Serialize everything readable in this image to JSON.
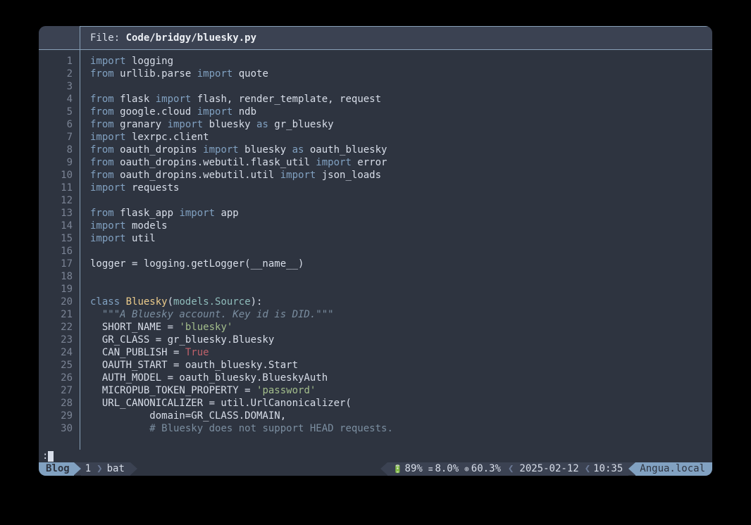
{
  "header": {
    "label": "File: ",
    "path": "Code/bridgy/bluesky.py"
  },
  "lines": [
    {
      "n": "1",
      "tokens": [
        {
          "c": "kw",
          "t": "import"
        },
        {
          "c": "fg",
          "t": " logging"
        }
      ]
    },
    {
      "n": "2",
      "tokens": [
        {
          "c": "kw",
          "t": "from"
        },
        {
          "c": "fg",
          "t": " urllib.parse "
        },
        {
          "c": "kw",
          "t": "import"
        },
        {
          "c": "fg",
          "t": " quote"
        }
      ]
    },
    {
      "n": "3",
      "tokens": []
    },
    {
      "n": "4",
      "tokens": [
        {
          "c": "kw",
          "t": "from"
        },
        {
          "c": "fg",
          "t": " flask "
        },
        {
          "c": "kw",
          "t": "import"
        },
        {
          "c": "fg",
          "t": " flash, render_template, request"
        }
      ]
    },
    {
      "n": "5",
      "tokens": [
        {
          "c": "kw",
          "t": "from"
        },
        {
          "c": "fg",
          "t": " google.cloud "
        },
        {
          "c": "kw",
          "t": "import"
        },
        {
          "c": "fg",
          "t": " ndb"
        }
      ]
    },
    {
      "n": "6",
      "tokens": [
        {
          "c": "kw",
          "t": "from"
        },
        {
          "c": "fg",
          "t": " granary "
        },
        {
          "c": "kw",
          "t": "import"
        },
        {
          "c": "fg",
          "t": " bluesky "
        },
        {
          "c": "kw",
          "t": "as"
        },
        {
          "c": "fg",
          "t": " gr_bluesky"
        }
      ]
    },
    {
      "n": "7",
      "tokens": [
        {
          "c": "kw",
          "t": "import"
        },
        {
          "c": "fg",
          "t": " lexrpc.client"
        }
      ]
    },
    {
      "n": "8",
      "tokens": [
        {
          "c": "kw",
          "t": "from"
        },
        {
          "c": "fg",
          "t": " oauth_dropins "
        },
        {
          "c": "kw",
          "t": "import"
        },
        {
          "c": "fg",
          "t": " bluesky "
        },
        {
          "c": "kw",
          "t": "as"
        },
        {
          "c": "fg",
          "t": " oauth_bluesky"
        }
      ]
    },
    {
      "n": "9",
      "tokens": [
        {
          "c": "kw",
          "t": "from"
        },
        {
          "c": "fg",
          "t": " oauth_dropins.webutil.flask_util "
        },
        {
          "c": "kw",
          "t": "import"
        },
        {
          "c": "fg",
          "t": " error"
        }
      ]
    },
    {
      "n": "10",
      "tokens": [
        {
          "c": "kw",
          "t": "from"
        },
        {
          "c": "fg",
          "t": " oauth_dropins.webutil.util "
        },
        {
          "c": "kw",
          "t": "import"
        },
        {
          "c": "fg",
          "t": " json_loads"
        }
      ]
    },
    {
      "n": "11",
      "tokens": [
        {
          "c": "kw",
          "t": "import"
        },
        {
          "c": "fg",
          "t": " requests"
        }
      ]
    },
    {
      "n": "12",
      "tokens": []
    },
    {
      "n": "13",
      "tokens": [
        {
          "c": "kw",
          "t": "from"
        },
        {
          "c": "fg",
          "t": " flask_app "
        },
        {
          "c": "kw",
          "t": "import"
        },
        {
          "c": "fg",
          "t": " app"
        }
      ]
    },
    {
      "n": "14",
      "tokens": [
        {
          "c": "kw",
          "t": "import"
        },
        {
          "c": "fg",
          "t": " models"
        }
      ]
    },
    {
      "n": "15",
      "tokens": [
        {
          "c": "kw",
          "t": "import"
        },
        {
          "c": "fg",
          "t": " util"
        }
      ]
    },
    {
      "n": "16",
      "tokens": []
    },
    {
      "n": "17",
      "tokens": [
        {
          "c": "fg",
          "t": "logger = logging.getLogger(__name__)"
        }
      ]
    },
    {
      "n": "18",
      "tokens": []
    },
    {
      "n": "19",
      "tokens": []
    },
    {
      "n": "20",
      "tokens": [
        {
          "c": "kw",
          "t": "class"
        },
        {
          "c": "fg",
          "t": " "
        },
        {
          "c": "cname",
          "t": "Bluesky"
        },
        {
          "c": "fg",
          "t": "("
        },
        {
          "c": "clsref",
          "t": "models.Source"
        },
        {
          "c": "fg",
          "t": "):"
        }
      ]
    },
    {
      "n": "21",
      "tokens": [
        {
          "c": "fg",
          "t": "  "
        },
        {
          "c": "doc",
          "t": "\"\"\"A Bluesky account. Key id is DID.\"\"\""
        }
      ]
    },
    {
      "n": "22",
      "tokens": [
        {
          "c": "fg",
          "t": "  SHORT_NAME = "
        },
        {
          "c": "str",
          "t": "'"
        },
        {
          "c": "str",
          "t": "bluesky"
        },
        {
          "c": "str",
          "t": "'"
        }
      ]
    },
    {
      "n": "23",
      "tokens": [
        {
          "c": "fg",
          "t": "  GR_CLASS = gr_bluesky.Bluesky"
        }
      ]
    },
    {
      "n": "24",
      "tokens": [
        {
          "c": "fg",
          "t": "  CAN_PUBLISH = "
        },
        {
          "c": "tru",
          "t": "True"
        }
      ]
    },
    {
      "n": "25",
      "tokens": [
        {
          "c": "fg",
          "t": "  OAUTH_START = oauth_bluesky.Start"
        }
      ]
    },
    {
      "n": "26",
      "tokens": [
        {
          "c": "fg",
          "t": "  AUTH_MODEL = oauth_bluesky.BlueskyAuth"
        }
      ]
    },
    {
      "n": "27",
      "tokens": [
        {
          "c": "fg",
          "t": "  MICROPUB_TOKEN_PROPERTY = "
        },
        {
          "c": "str",
          "t": "'"
        },
        {
          "c": "str",
          "t": "password"
        },
        {
          "c": "str",
          "t": "'"
        }
      ]
    },
    {
      "n": "28",
      "tokens": [
        {
          "c": "fg",
          "t": "  URL_CANONICALIZER = util.UrlCanonicalizer("
        }
      ]
    },
    {
      "n": "29",
      "tokens": [
        {
          "c": "fg",
          "t": "          domain=GR_CLASS.DOMAIN,"
        }
      ]
    },
    {
      "n": "30",
      "tokens": [
        {
          "c": "fg",
          "t": "          "
        },
        {
          "c": "cmt",
          "t": "# Bluesky does not support HEAD requests."
        }
      ]
    }
  ],
  "cmd": {
    "prompt": ":"
  },
  "status": {
    "session": "Blog",
    "window_num": "1",
    "command": "bat",
    "battery": "89%",
    "mem": "8.0%",
    "cpu": "60.3%",
    "date": "2025-02-12",
    "time": "10:35",
    "host": "Angua.local"
  }
}
